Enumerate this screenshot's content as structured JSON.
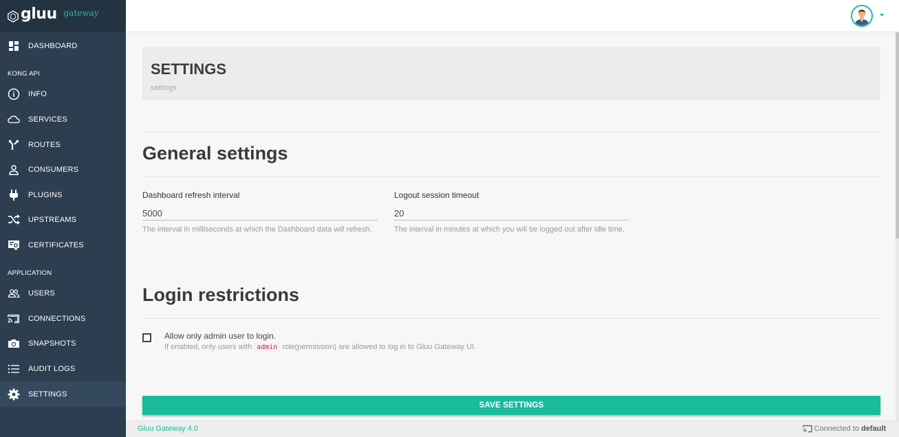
{
  "app": {
    "logo_text": "gluu",
    "logo_sub": "gateway",
    "brand_color": "#1abc9c",
    "sidebar_color": "#2c3e50"
  },
  "sidebar": {
    "items": [
      {
        "label": "DASHBOARD",
        "icon": "dashboard-icon"
      },
      {
        "label": "INFO",
        "icon": "info-icon"
      },
      {
        "label": "SERVICES",
        "icon": "cloud-icon"
      },
      {
        "label": "ROUTES",
        "icon": "routes-icon"
      },
      {
        "label": "CONSUMERS",
        "icon": "person-icon"
      },
      {
        "label": "PLUGINS",
        "icon": "plug-icon"
      },
      {
        "label": "UPSTREAMS",
        "icon": "shuffle-icon"
      },
      {
        "label": "CERTIFICATES",
        "icon": "certificate-icon"
      },
      {
        "label": "USERS",
        "icon": "people-icon"
      },
      {
        "label": "CONNECTIONS",
        "icon": "cast-icon"
      },
      {
        "label": "SNAPSHOTS",
        "icon": "camera-icon"
      },
      {
        "label": "AUDIT LOGS",
        "icon": "list-icon"
      },
      {
        "label": "SETTINGS",
        "icon": "gear-icon",
        "active": true
      }
    ],
    "sections": {
      "kong_api": "KONG API",
      "application": "APPLICATION"
    }
  },
  "page": {
    "title": "SETTINGS",
    "breadcrumb": "settings"
  },
  "general": {
    "title": "General settings",
    "refresh": {
      "label": "Dashboard refresh interval",
      "value": "5000",
      "help": "The interval in milliseconds at which the Dashboard data will refresh."
    },
    "logout": {
      "label": "Logout session timeout",
      "value": "20",
      "help": "The interval in minutes at which you will be logged out after idle time."
    }
  },
  "login": {
    "title": "Login restrictions",
    "checkbox_label": "Allow only admin user to login.",
    "checked": false,
    "help_prefix": "If enabled, only users with",
    "help_code": "admin",
    "help_suffix": "role(permission) are allowed to log in to Gluu Gateway UI."
  },
  "save_button": "SAVE SETTINGS",
  "footer": {
    "version": "Gluu Gateway 4.0",
    "connected_prefix": "Connected to",
    "connected_name": "default"
  }
}
